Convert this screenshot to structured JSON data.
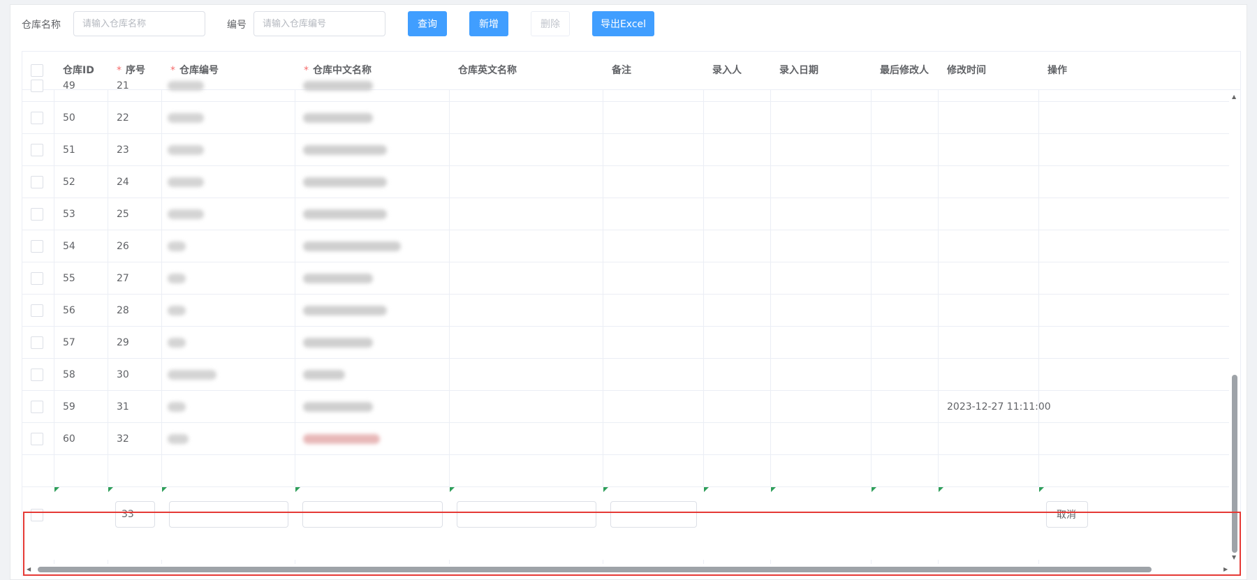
{
  "toolbar": {
    "name_label": "仓库名称",
    "name_placeholder": "请输入仓库名称",
    "code_label": "编号",
    "code_placeholder": "请输入仓库编号",
    "query": "查询",
    "add": "新增",
    "delete": "删除",
    "export": "导出Excel"
  },
  "table": {
    "headers": {
      "id": "仓库ID",
      "seq": "序号",
      "code": "仓库编号",
      "cn_name": "仓库中文名称",
      "en_name": "仓库英文名称",
      "remark": "备注",
      "creator": "录入人",
      "create_date": "录入日期",
      "modifier": "最后修改人",
      "modify_time": "修改时间",
      "ops": "操作"
    },
    "required_mark": "*",
    "rows": [
      {
        "id": "49",
        "seq": "21",
        "modify_time": ""
      },
      {
        "id": "50",
        "seq": "22",
        "modify_time": ""
      },
      {
        "id": "51",
        "seq": "23",
        "modify_time": ""
      },
      {
        "id": "52",
        "seq": "24",
        "modify_time": ""
      },
      {
        "id": "53",
        "seq": "25",
        "modify_time": ""
      },
      {
        "id": "54",
        "seq": "26",
        "modify_time": ""
      },
      {
        "id": "55",
        "seq": "27",
        "modify_time": ""
      },
      {
        "id": "56",
        "seq": "28",
        "modify_time": ""
      },
      {
        "id": "57",
        "seq": "29",
        "modify_time": ""
      },
      {
        "id": "58",
        "seq": "30",
        "modify_time": ""
      },
      {
        "id": "59",
        "seq": "31",
        "modify_time": "2023-12-27 11:11:00"
      },
      {
        "id": "60",
        "seq": "32",
        "modify_time": ""
      }
    ],
    "edit_row": {
      "seq_value": "33",
      "cancel": "取消"
    }
  }
}
